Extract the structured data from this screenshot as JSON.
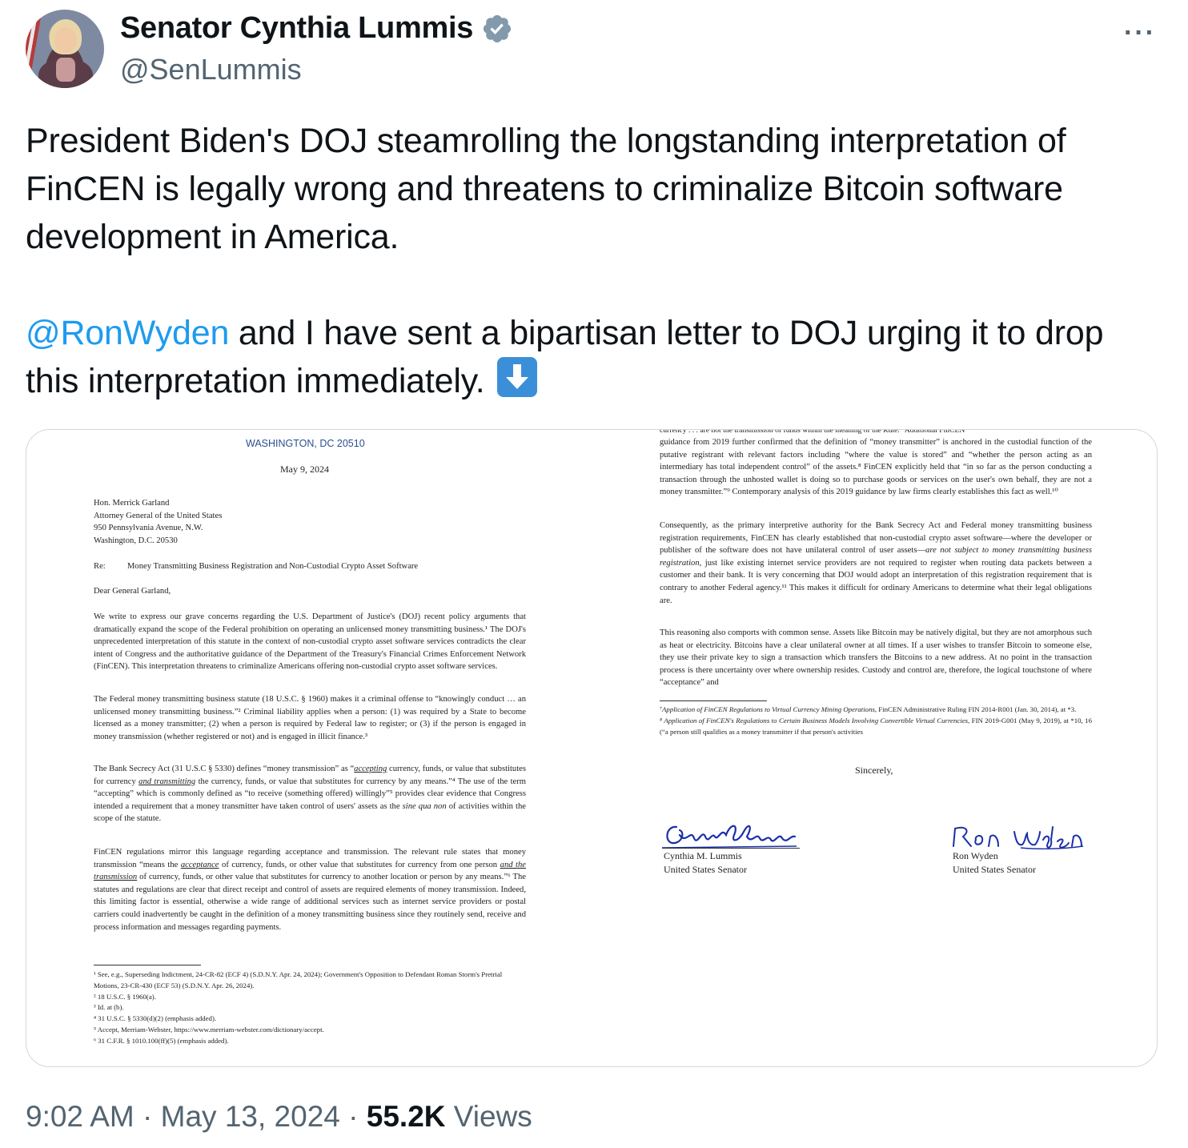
{
  "author": {
    "display_name": "Senator Cynthia Lummis",
    "handle": "@SenLummis",
    "verified_icon": "verified-badge-icon",
    "more_label": "···"
  },
  "tweet": {
    "para1": "President Biden's DOJ steamrolling the longstanding interpretation of FinCEN is legally wrong and threatens to criminalize Bitcoin software development in America.",
    "mention": "@RonWyden",
    "para2_rest": " and I have sent a bipartisan letter to DOJ urging it to drop this interpretation immediately.",
    "emoji_icon": "down-arrow-emoji-icon"
  },
  "letter_left": {
    "location": "WASHINGTON, DC 20510",
    "date": "May 9, 2024",
    "address": [
      "Hon. Merrick Garland",
      "Attorney General of the United States",
      "950 Pennsylvania Avenue, N.W.",
      "Washington, D.C. 20530"
    ],
    "re_label": "Re:",
    "re_text": "Money Transmitting Business Registration and Non-Custodial Crypto Asset Software",
    "salutation": "Dear General Garland,",
    "p1": "We write to express our grave concerns regarding the U.S. Department of Justice's (DOJ) recent policy arguments that dramatically expand the scope of the Federal prohibition on operating an unlicensed money transmitting business.¹ The DOJ's unprecedented interpretation of this statute in the context of non-custodial crypto asset software services contradicts the clear intent of Congress and the authoritative guidance of the Department of the Treasury's Financial Crimes Enforcement Network (FinCEN). This interpretation threatens to criminalize Americans offering non-custodial crypto asset software services.",
    "p2": "The Federal money transmitting business statute (18 U.S.C. § 1960) makes it a criminal offense to “knowingly conduct … an unlicensed money transmitting business.”² Criminal liability applies when a person: (1) was required by a State to become licensed as a money transmitter; (2) when a person is required by Federal law to register; or (3) if the person is engaged in money transmission (whether registered or not) and is engaged in illicit finance.³",
    "p3a": "The Bank Secrecy Act (31 U.S.C § 5330) defines “money transmission” as “",
    "p3_u1": "accepting",
    "p3b": " currency, funds, or value that substitutes for currency ",
    "p3_u2": "and transmitting",
    "p3c": " the currency, funds, or value that substitutes for currency by any means.”⁴ The use of the term “accepting” which is commonly defined as “to receive (something offered) willingly”⁵ provides clear evidence that Congress intended a requirement that a money transmitter have taken control of users' assets as the ",
    "p3_i": "sine qua non",
    "p3d": " of activities within the scope of the statute.",
    "p4a": "FinCEN regulations mirror this language regarding acceptance and transmission. The relevant rule states that money transmission “means the ",
    "p4_u1": "acceptance",
    "p4b": " of currency, funds, or other value that substitutes for currency from one person ",
    "p4_u2": "and the transmission",
    "p4c": " of currency, funds, or other value that substitutes for currency to another location or person by any means.”⁶ The statutes and regulations are clear that direct receipt and control of assets are required elements of money transmission. Indeed, this limiting factor is essential, otherwise a wide range of additional services such as internet service providers or postal carriers could inadvertently be caught in the definition of a money transmitting business since they routinely send, receive and process information and messages regarding payments.",
    "footnotes": [
      "¹ See, e.g., Superseding Indictment, 24-CR-82 (ECF 4) (S.D.N.Y. Apr. 24, 2024); Government's Opposition to Defendant Roman Storm's Pretrial Motions, 23-CR-430 (ECF 53) (S.D.N.Y. Apr. 26, 2024).",
      "² 18 U.S.C. § 1960(a).",
      "³ Id. at (b).",
      "⁴ 31 U.S.C. § 5330(d)(2) (emphasis added).",
      "⁵ Accept, Merriam-Webster, https://www.merriam-webster.com/dictionary/accept.",
      "⁶ 31 C.F.R. § 1010.100(ff)(5) (emphasis added)."
    ]
  },
  "letter_right": {
    "p0_cut": "currency . . . are not the transmission of funds within the meaning of the Rule.” Additional FinCEN",
    "p1": "guidance from 2019 further confirmed that the definition of “money transmitter” is anchored in the custodial function of the putative registrant with relevant factors including “where the value is stored” and “whether the person acting as an intermediary has total independent control” of the assets.⁸ FinCEN explicitly held that “in so far as the person conducting a transaction through the unhosted wallet is doing so to purchase goods or services on the user's own behalf, they are not a money transmitter.”⁹ Contemporary analysis of this 2019 guidance by law firms clearly establishes this fact as well.¹⁰",
    "p2a": "Consequently, as the primary interpretive authority for the Bank Secrecy Act and Federal money transmitting business registration requirements, FinCEN has clearly established that non-custodial crypto asset software—where the developer or publisher of the software does not have unilateral control of user assets—",
    "p2_i": "are not subject to money transmitting business registration",
    "p2b": ", just like existing internet service providers are not required to register when routing data packets between a customer and their bank. It is very concerning that DOJ would adopt an interpretation of this registration requirement that is contrary to another Federal agency.¹¹ This makes it difficult for ordinary Americans to determine what their legal obligations are.",
    "p3": "This reasoning also comports with common sense. Assets like Bitcoin may be natively digital, but they are not amorphous such as heat or electricity. Bitcoins have a clear unilateral owner at all times. If a user wishes to transfer Bitcoin to someone else, they use their private key to sign a transaction which transfers the Bitcoins to a new address. At no point in the transaction process is there uncertainty over where ownership resides. Custody and control are, therefore, the logical touchstone of where “acceptance” and",
    "fn7a": "⁷Application of FinCEN Regulations to Virtual Currency Mining Operations",
    "fn7b": ", FinCEN Administrative Ruling FIN 2014-R001 (Jan. 30, 2014), at *3.",
    "fn8a": "⁸ Application of FinCEN's Regulations to Certain Business Models Involving Convertible Virtual Currencies",
    "fn8b": ", FIN 2019-G001 (May 9, 2019), at *10, 16 (“a person still qualifies as a money transmitter if that person's activities",
    "closing": "Sincerely,",
    "sig1_name": "Cynthia M. Lummis",
    "sig1_title": "United States Senator",
    "sig2_name": "Ron Wyden",
    "sig2_title": "United States Senator"
  },
  "footer": {
    "time": "9:02 AM",
    "sep1": " · ",
    "date": "May 13, 2024",
    "sep2": " · ",
    "views_count": "55.2K",
    "views_label": " Views"
  },
  "colors": {
    "text": "#0f1419",
    "secondary": "#536471",
    "link": "#1d9bf0",
    "border": "#cfd9de",
    "verified": "#829aab",
    "letterhead": "#2b4f8f",
    "signature_ink": "#1a2fa8"
  }
}
